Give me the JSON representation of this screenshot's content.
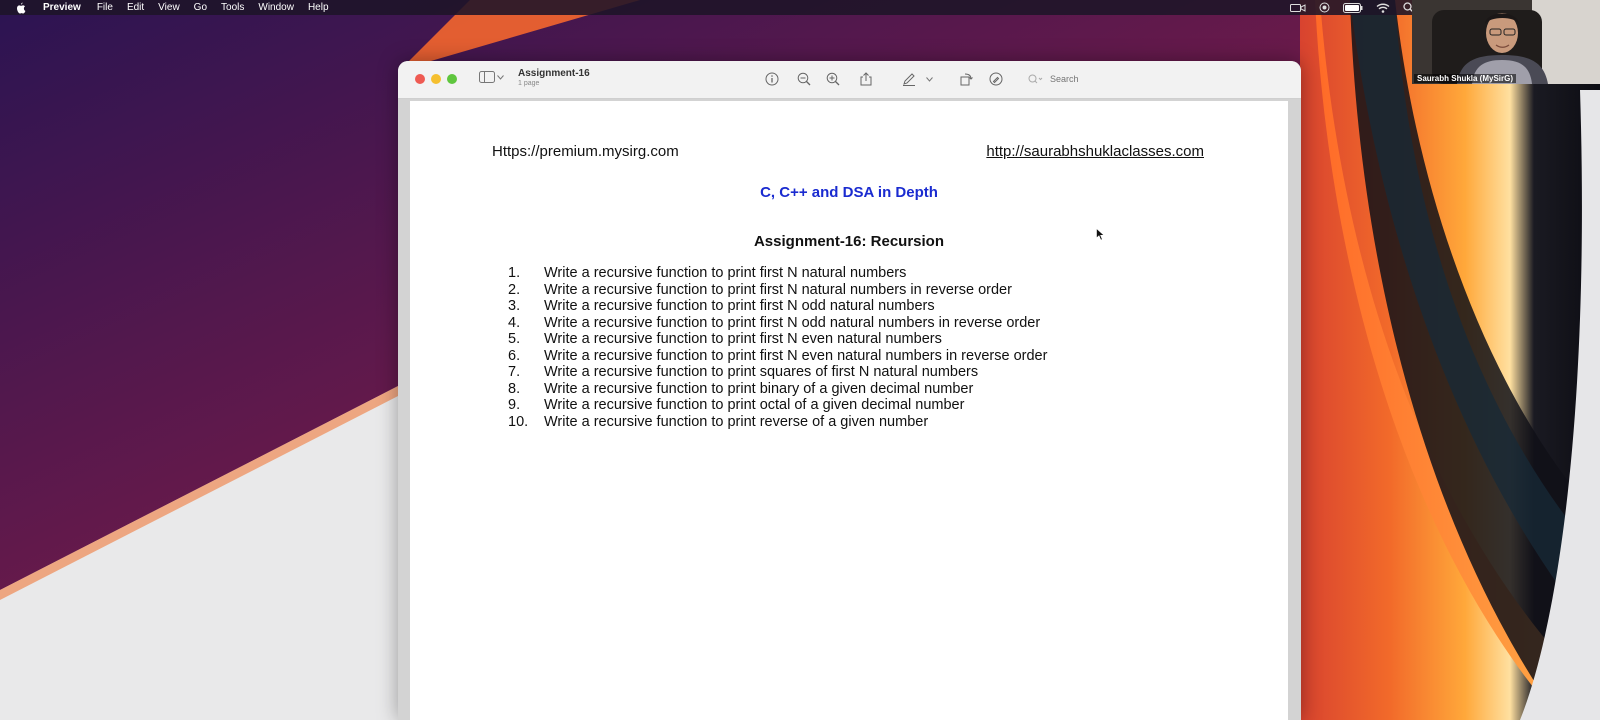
{
  "menubar": {
    "app_name": "Preview",
    "menus": [
      "File",
      "Edit",
      "View",
      "Go",
      "Tools",
      "Window",
      "Help"
    ],
    "status_icons": [
      "camera-icon",
      "screen-record-icon",
      "battery-icon",
      "wifi-icon",
      "search-icon"
    ]
  },
  "webcam": {
    "participant_name": "Saurabh Shukla (MySirG)"
  },
  "window": {
    "doc_title": "Assignment-16",
    "doc_subtitle": "1 page",
    "search_placeholder": "Search",
    "toolbar_icons": [
      "info-icon",
      "zoom-out-icon",
      "zoom-in-icon",
      "share-icon",
      "markup-pen-icon",
      "chevron-down-icon",
      "rotate-icon",
      "markup-icon"
    ]
  },
  "document": {
    "link_left": "Https://premium.mysirg.com",
    "link_right": "http://saurabhshuklaclasses.com",
    "course_title": "C, C++ and DSA in Depth",
    "assignment_title": "Assignment-16: Recursion",
    "questions": [
      {
        "num": "1.",
        "text": "Write a recursive function to print first N natural numbers"
      },
      {
        "num": "2.",
        "text": "Write a recursive function to print first N natural numbers in reverse order"
      },
      {
        "num": "3.",
        "text": "Write a recursive function to print first N odd natural numbers"
      },
      {
        "num": "4.",
        "text": "Write a recursive function to print first N odd natural numbers in reverse order"
      },
      {
        "num": "5.",
        "text": "Write a recursive function to print first N even natural numbers"
      },
      {
        "num": "6.",
        "text": "Write a recursive function to print first N even natural numbers in reverse order"
      },
      {
        "num": "7.",
        "text": "Write a recursive function to print squares of first N natural numbers"
      },
      {
        "num": "8.",
        "text": "Write a recursive function to print binary of a given decimal number"
      },
      {
        "num": "9.",
        "text": "Write a recursive function to print octal of a given decimal number"
      },
      {
        "num": "10.",
        "text": "Write a recursive function to print reverse of a given number"
      }
    ]
  },
  "colors": {
    "course_title": "#1a2bd0",
    "close_button": "#ee5a52",
    "minimize_button": "#f5bf2f",
    "zoom_button": "#5fc63e"
  }
}
